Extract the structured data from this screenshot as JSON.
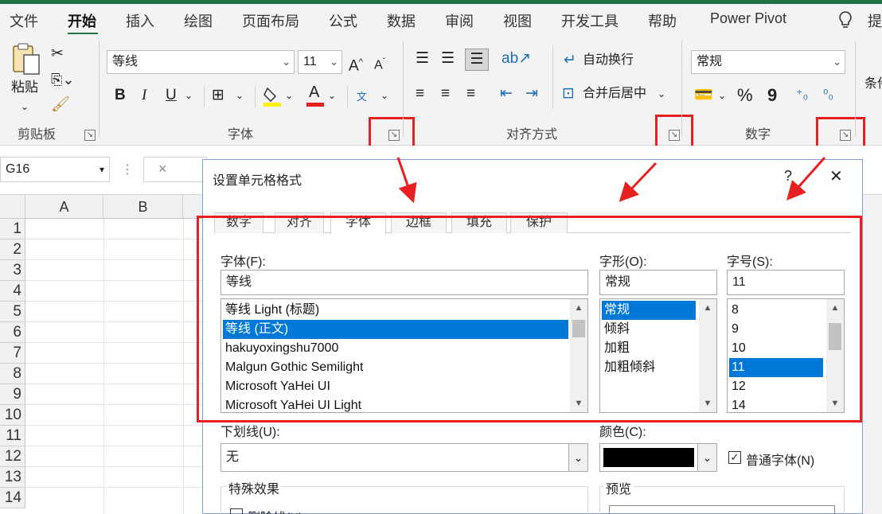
{
  "menu": {
    "items": [
      "文件",
      "开始",
      "插入",
      "绘图",
      "页面布局",
      "公式",
      "数据",
      "审阅",
      "视图",
      "开发工具",
      "帮助",
      "Power Pivot"
    ],
    "active": "开始",
    "help_icon": "lightbulb-icon",
    "search_hint": "提"
  },
  "ribbon": {
    "clipboard": {
      "paste_label": "粘贴",
      "group_label": "剪贴板"
    },
    "font": {
      "font_name": "等线",
      "font_size": "11",
      "grow": "A^",
      "shrink": "A^",
      "bold": "B",
      "italic": "I",
      "underline": "U",
      "font_color_letter": "A",
      "phonetic": "文",
      "group_label": "字体"
    },
    "alignment": {
      "wrap_text": "自动换行",
      "merge_center": "合并后居中",
      "group_label": "对齐方式"
    },
    "number": {
      "format": "常规",
      "percent": "%",
      "comma": "9",
      "group_label": "数字"
    },
    "styles": {
      "conditional": "条件"
    }
  },
  "formula_bar": {
    "name_box": "G16",
    "cancel": "×"
  },
  "sheet": {
    "columns": [
      "A",
      "B"
    ],
    "rows": [
      "1",
      "2",
      "3",
      "4",
      "5",
      "6",
      "7",
      "8",
      "9",
      "10",
      "11",
      "12",
      "13",
      "14"
    ]
  },
  "dialog": {
    "title": "设置单元格格式",
    "help": "?",
    "close": "✕",
    "tabs": [
      "数字",
      "对齐",
      "字体",
      "边框",
      "填充",
      "保护"
    ],
    "active_tab": "字体",
    "font": {
      "label": "字体(F):",
      "value": "等线",
      "options": [
        "等线 Light (标题)",
        "等线 (正文)",
        "hakuyoxingshu7000",
        "Malgun Gothic Semilight",
        "Microsoft YaHei UI",
        "Microsoft YaHei UI Light"
      ],
      "selected_index": 1
    },
    "style": {
      "label": "字形(O):",
      "value": "常规",
      "options": [
        "常规",
        "倾斜",
        "加粗",
        "加粗倾斜"
      ],
      "selected_index": 0
    },
    "size": {
      "label": "字号(S):",
      "value": "11",
      "options": [
        "8",
        "9",
        "10",
        "11",
        "12",
        "14"
      ],
      "selected_index": 3
    },
    "underline": {
      "label": "下划线(U):",
      "value": "无"
    },
    "color": {
      "label": "颜色(C):",
      "swatch": "#000000"
    },
    "normal_font": {
      "label": "普通字体(N)",
      "checked": true
    },
    "effects": {
      "label": "特殊效果",
      "strikethrough": "删除线(K)"
    },
    "preview": {
      "label": "预览"
    }
  },
  "colors": {
    "accent": "#217346",
    "highlight": "#e8201f",
    "selection": "#0078d7"
  }
}
